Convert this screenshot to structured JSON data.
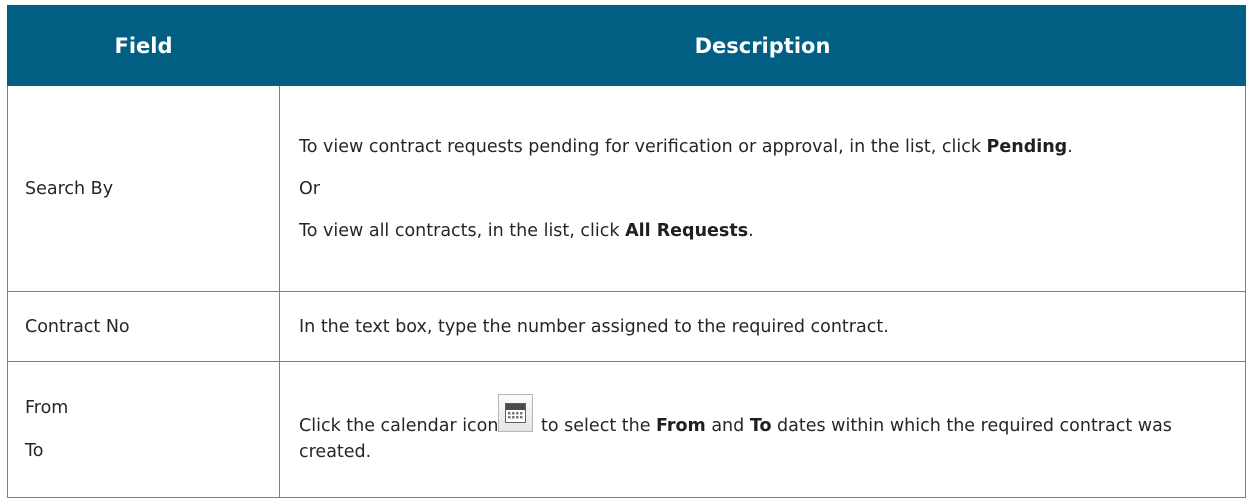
{
  "table": {
    "headers": {
      "field": "Field",
      "description": "Description"
    },
    "rows": [
      {
        "field": "Search By",
        "description": {
          "p1_text": "To view contract requests pending for verification or approval, in the list, click ",
          "p1_bold": "Pending",
          "p1_end": ".",
          "p2": "Or",
          "p3_text": "To view all contracts, in the list, click ",
          "p3_bold": "All Requests",
          "p3_end": "."
        }
      },
      {
        "field": "Contract No",
        "description": "In the text box, type the number assigned to the required contract."
      },
      {
        "field_line1": "From",
        "field_line2": "To",
        "description": {
          "before_icon": "Click the calendar icon",
          "after_icon": " to select the ",
          "bold1": "From",
          "mid": " and ",
          "bold2": "To",
          "end": " dates within which the required contract was created.",
          "icon": "calendar-icon"
        }
      }
    ]
  },
  "colors": {
    "header_bg": "#005f82",
    "header_text": "#ffffff",
    "border": "#7f7f7f",
    "body_text": "#262626"
  }
}
